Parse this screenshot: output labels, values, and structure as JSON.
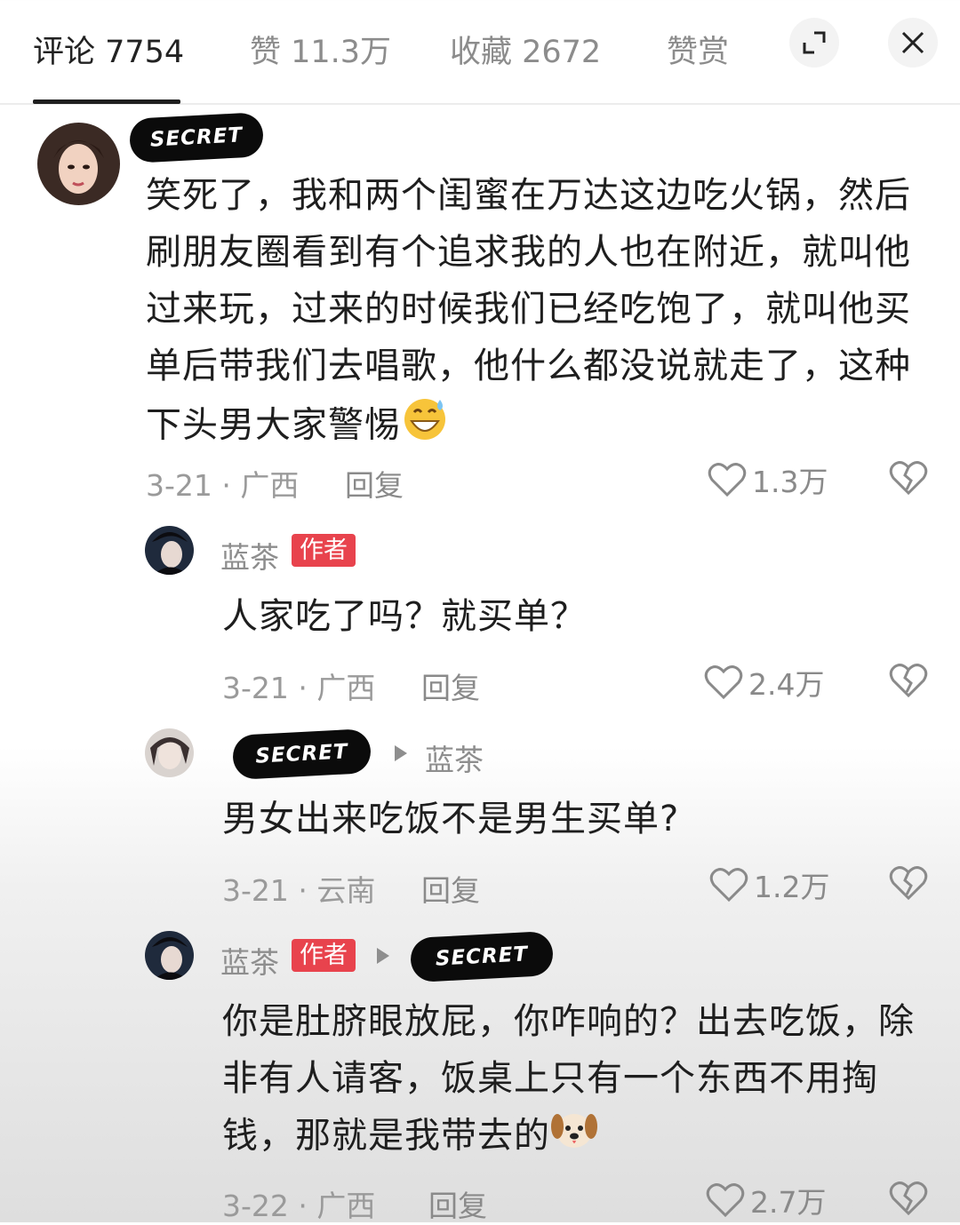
{
  "tabs": [
    {
      "label": "评论 7754"
    },
    {
      "label": "赞 11.3万"
    },
    {
      "label": "收藏 2672"
    },
    {
      "label": "赞赏"
    }
  ],
  "redaction_label": "SECRET",
  "comments": [
    {
      "username": "",
      "text": "笑死了，我和两个闺蜜在万达这边吃火锅，然后刷朋友圈看到有个追求我的人也在附近，就叫他过来玩，过来的时候我们已经吃饱了，就叫他买单后带我们去唱歌，他什么都没说就走了，这种下头男大家警惕",
      "emoji": "sweat-smile-emoji",
      "date_location": "3-21 · 广西",
      "reply": "回复",
      "likes": "1.3万"
    },
    {
      "username": "蓝茶",
      "tag": "作者",
      "text": "人家吃了吗？就买单？",
      "date_location": "3-21 · 广西",
      "reply": "回复",
      "likes": "2.4万"
    },
    {
      "username": "",
      "reply_to": "蓝茶",
      "text": "男女出来吃饭不是男生买单?",
      "date_location": "3-21 · 云南",
      "reply": "回复",
      "likes": "1.2万"
    },
    {
      "username": "蓝茶",
      "tag": "作者",
      "text": "你是肚脐眼放屁，你咋响的？出去吃饭，除非有人请客，饭桌上只有一个东西不用掏钱，那就是我带去的",
      "emoji": "dog-emoji",
      "date_location": "3-22 · 广西",
      "reply": "回复",
      "likes": "2.7万"
    }
  ]
}
